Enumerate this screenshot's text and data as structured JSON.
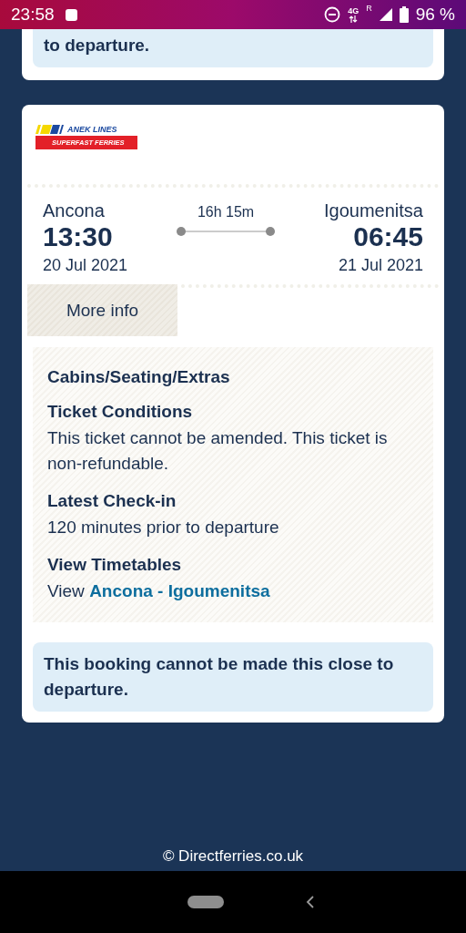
{
  "status_bar": {
    "time": "23:58",
    "network": "4G",
    "roaming": "R",
    "battery": "96 %"
  },
  "previous_card": {
    "alert": "to departure."
  },
  "result_card": {
    "operator": {
      "line1": "ANEK LINES",
      "line2": "SUPERFAST FERRIES"
    },
    "departure": {
      "port": "Ancona",
      "time": "13:30",
      "date": "20 Jul 2021"
    },
    "duration": "16h 15m",
    "arrival": {
      "port": "Igoumenitsa",
      "time": "06:45",
      "date": "21 Jul 2021"
    },
    "more_info_button": "More info",
    "details": [
      {
        "heading": "Cabins/Seating/Extras"
      },
      {
        "heading": "Ticket Conditions",
        "text": "This ticket cannot be amended. This ticket is non-refundable."
      },
      {
        "heading": "Latest Check-in",
        "text": "120 minutes prior to departure"
      },
      {
        "heading": "View Timetables",
        "prefix": "View",
        "link": "Ancona - Igoumenitsa"
      }
    ],
    "alert": "This booking cannot be made this close to departure."
  },
  "footer": "© Directferries.co.uk"
}
